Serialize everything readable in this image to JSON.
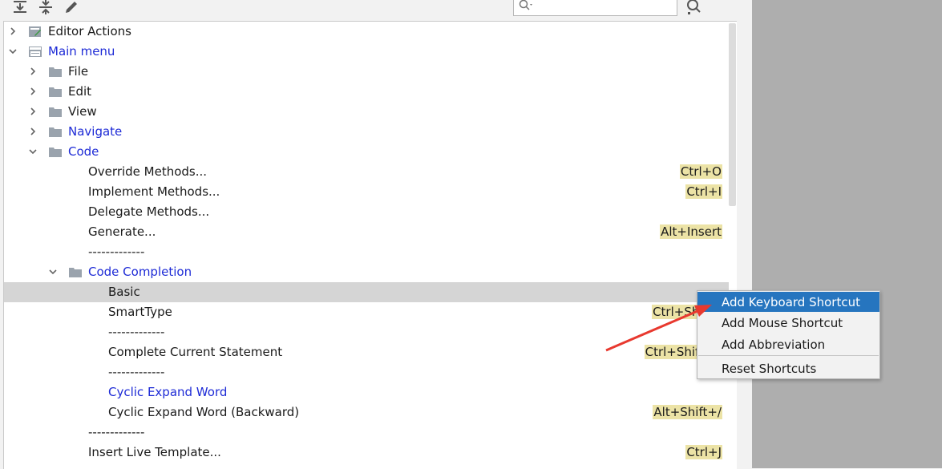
{
  "toolbar": {
    "search_value": "",
    "icons": [
      "expand-all-icon",
      "collapse-all-icon",
      "edit-icon",
      "search-icon",
      "find-by-shortcut-icon"
    ]
  },
  "tree": {
    "rows": [
      {
        "label": "Editor Actions",
        "blue": false,
        "shortcut": ""
      },
      {
        "label": "Main menu",
        "blue": true,
        "shortcut": ""
      },
      {
        "label": "File",
        "blue": false,
        "shortcut": ""
      },
      {
        "label": "Edit",
        "blue": false,
        "shortcut": ""
      },
      {
        "label": "View",
        "blue": false,
        "shortcut": ""
      },
      {
        "label": "Navigate",
        "blue": true,
        "shortcut": ""
      },
      {
        "label": "Code",
        "blue": true,
        "shortcut": ""
      },
      {
        "label": "Override Methods...",
        "blue": false,
        "shortcut": "Ctrl+O"
      },
      {
        "label": "Implement Methods...",
        "blue": false,
        "shortcut": "Ctrl+I"
      },
      {
        "label": "Delegate Methods...",
        "blue": false,
        "shortcut": ""
      },
      {
        "label": "Generate...",
        "blue": false,
        "shortcut": "Alt+Insert"
      },
      {
        "label": "-------------",
        "blue": false,
        "shortcut": ""
      },
      {
        "label": "Code Completion",
        "blue": true,
        "shortcut": ""
      },
      {
        "label": "Basic",
        "blue": false,
        "shortcut": "",
        "selected": true
      },
      {
        "label": "SmartType",
        "blue": false,
        "shortcut": "Ctrl+Shift+"
      },
      {
        "label": "-------------",
        "blue": false,
        "shortcut": ""
      },
      {
        "label": "Complete Current Statement",
        "blue": false,
        "shortcut": "Ctrl+Shift+E"
      },
      {
        "label": "-------------",
        "blue": false,
        "shortcut": ""
      },
      {
        "label": "Cyclic Expand Word",
        "blue": true,
        "shortcut": ""
      },
      {
        "label": "Cyclic Expand Word (Backward)",
        "blue": false,
        "shortcut": "Alt+Shift+/"
      },
      {
        "label": "-------------",
        "blue": false,
        "shortcut": ""
      },
      {
        "label": "Insert Live Template...",
        "blue": false,
        "shortcut": "Ctrl+J"
      }
    ]
  },
  "context_menu": {
    "items": [
      "Add Keyboard Shortcut",
      "Add Mouse Shortcut",
      "Add Abbreviation",
      "Reset Shortcuts"
    ]
  },
  "colors": {
    "selection": "#d5d5d5",
    "menu_highlight": "#2675bf",
    "shortcut_bg": "#ece3a6",
    "modified_text": "#1e2bd6",
    "annotation_arrow": "#e8392f"
  }
}
